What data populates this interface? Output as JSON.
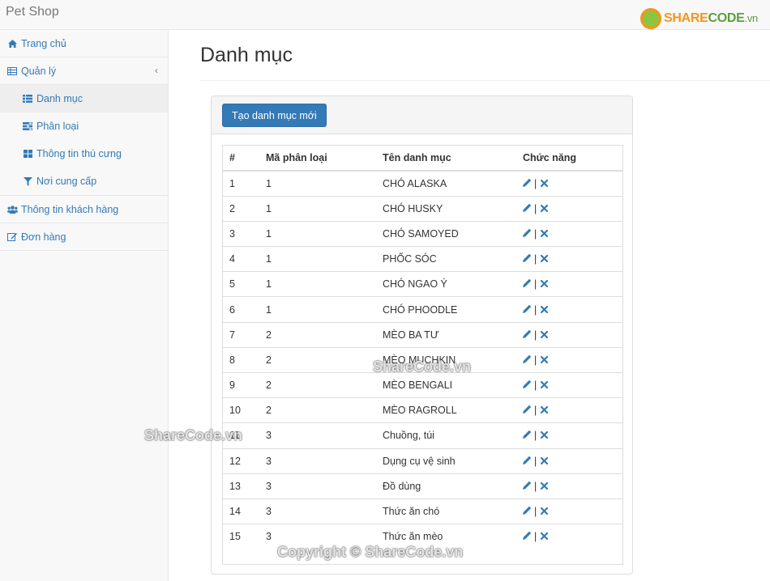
{
  "app": {
    "brand": "Pet Shop"
  },
  "logo": {
    "part1": "SHARE",
    "part2": "CODE",
    "part3": ".vn"
  },
  "sidebar": {
    "items": [
      {
        "icon": "home-icon",
        "label": "Trang chủ"
      },
      {
        "icon": "table-icon",
        "label": "Quản lý",
        "chevron": "‹"
      },
      {
        "icon": "list-icon",
        "label": "Danh mục"
      },
      {
        "icon": "tasks-icon",
        "label": "Phân loại"
      },
      {
        "icon": "grid-icon",
        "label": "Thông tin thú cưng"
      },
      {
        "icon": "filter-icon",
        "label": "Nơi cung cấp"
      },
      {
        "icon": "users-icon",
        "label": "Thông tin khách hàng"
      },
      {
        "icon": "edit-icon",
        "label": "Đơn hàng"
      }
    ]
  },
  "main": {
    "title": "Danh mục",
    "create_button": "Tạo danh mục mới",
    "table": {
      "headers": [
        "#",
        "Mã phân loại",
        "Tên danh mục",
        "Chức năng"
      ],
      "separator": "|",
      "rows": [
        [
          "1",
          "1",
          "CHÓ ALASKA"
        ],
        [
          "2",
          "1",
          "CHÓ HUSKY"
        ],
        [
          "3",
          "1",
          "CHÓ SAMOYED"
        ],
        [
          "4",
          "1",
          "PHỐC SÓC"
        ],
        [
          "5",
          "1",
          "CHÓ NGAO Ý"
        ],
        [
          "6",
          "1",
          "CHÓ PHOODLE"
        ],
        [
          "7",
          "2",
          "MÈO BA TƯ"
        ],
        [
          "8",
          "2",
          "MÈO MUCHKIN"
        ],
        [
          "9",
          "2",
          "MÈO BENGALI"
        ],
        [
          "10",
          "2",
          "MÈO RAGROLL"
        ],
        [
          "11",
          "3",
          "Chuồng, túi"
        ],
        [
          "12",
          "3",
          "Dụng cụ vệ sinh"
        ],
        [
          "13",
          "3",
          "Đồ dùng"
        ],
        [
          "14",
          "3",
          "Thức ăn chó"
        ],
        [
          "15",
          "3",
          "Thức ăn mèo"
        ]
      ]
    }
  },
  "watermarks": {
    "center": "ShareCode.vn",
    "left": "ShareCode.vn",
    "bottom": "Copyright © ShareCode.vn"
  }
}
